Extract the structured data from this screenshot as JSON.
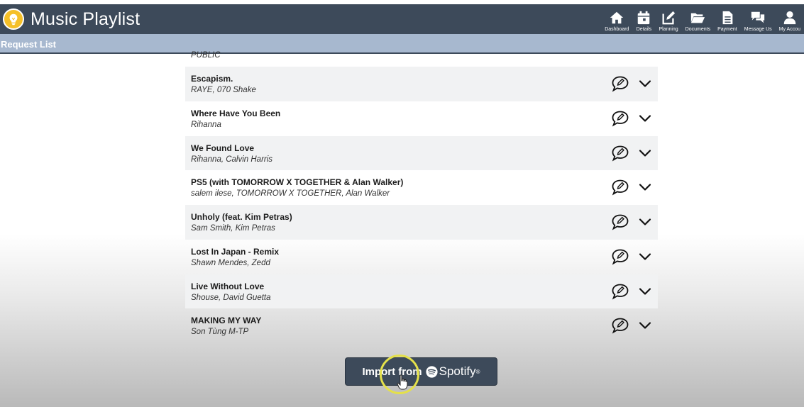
{
  "app": {
    "title": "Music Playlist"
  },
  "nav": [
    {
      "label": "Dashboard",
      "icon": "home-icon"
    },
    {
      "label": "Details",
      "icon": "calendar-icon"
    },
    {
      "label": "Planning",
      "icon": "edit-icon"
    },
    {
      "label": "Documents",
      "icon": "folder-icon"
    },
    {
      "label": "Payment",
      "icon": "document-icon"
    },
    {
      "label": "Message Us",
      "icon": "chat-icon"
    },
    {
      "label": "My Accou",
      "icon": "user-icon"
    }
  ],
  "subheader": {
    "label": "Request List"
  },
  "list": {
    "partial_artist": "PUBLIC",
    "songs": [
      {
        "title": "Escapism.",
        "artist": "RAYE, 070 Shake"
      },
      {
        "title": "Where Have You Been",
        "artist": "Rihanna"
      },
      {
        "title": "We Found Love",
        "artist": "Rihanna, Calvin Harris"
      },
      {
        "title": "PS5 (with TOMORROW X TOGETHER & Alan Walker)",
        "artist": "salem ilese, TOMORROW X TOGETHER, Alan Walker"
      },
      {
        "title": "Unholy (feat. Kim Petras)",
        "artist": "Sam Smith, Kim Petras"
      },
      {
        "title": "Lost In Japan - Remix",
        "artist": "Shawn Mendes, Zedd"
      },
      {
        "title": "Live Without Love",
        "artist": "Shouse, David Guetta"
      },
      {
        "title": "MAKING MY WAY",
        "artist": "Son Tùng M-TP"
      }
    ]
  },
  "import_button": {
    "label": "Import from",
    "service": "Spotify",
    "reg_mark": "®"
  },
  "colors": {
    "header": "#3d4a5a",
    "subheader": "#a7b8cf",
    "logo": "#f5c028",
    "row_shade": "#f1f2f3"
  }
}
